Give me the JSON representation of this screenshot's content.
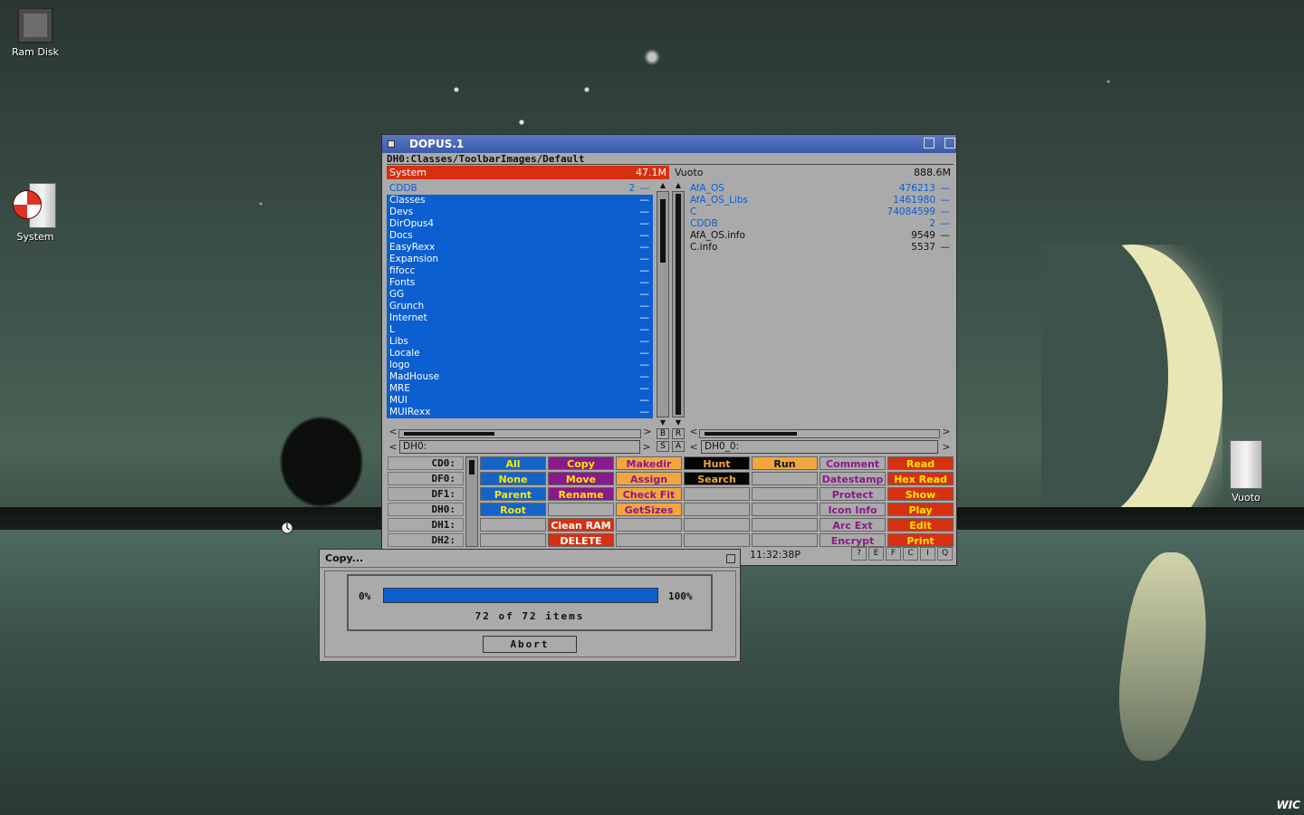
{
  "desktop": {
    "icons": [
      {
        "label": "Ram Disk"
      },
      {
        "label": "System"
      },
      {
        "label": "Vuoto"
      }
    ],
    "corner_logo": "WIC"
  },
  "window": {
    "title": "DOPUS.1",
    "path": "DH0:Classes/ToolbarImages/Default",
    "left": {
      "name": "System",
      "free": "47.1M",
      "path": "DH0:",
      "items": [
        {
          "name": "CDDB",
          "size": "2",
          "tail": "—",
          "kind": "dir"
        },
        {
          "name": "Classes",
          "size": "",
          "tail": "—",
          "kind": "dir-sel"
        },
        {
          "name": "Devs",
          "size": "",
          "tail": "—",
          "kind": "dir-sel"
        },
        {
          "name": "DirOpus4",
          "size": "",
          "tail": "—",
          "kind": "dir-sel"
        },
        {
          "name": "Docs",
          "size": "",
          "tail": "—",
          "kind": "dir-sel"
        },
        {
          "name": "EasyRexx",
          "size": "",
          "tail": "—",
          "kind": "dir-sel"
        },
        {
          "name": "Expansion",
          "size": "",
          "tail": "—",
          "kind": "dir-sel"
        },
        {
          "name": "fifocc",
          "size": "",
          "tail": "—",
          "kind": "dir-sel"
        },
        {
          "name": "Fonts",
          "size": "",
          "tail": "—",
          "kind": "dir-sel"
        },
        {
          "name": "GG",
          "size": "",
          "tail": "—",
          "kind": "dir-sel"
        },
        {
          "name": "Grunch",
          "size": "",
          "tail": "—",
          "kind": "dir-sel"
        },
        {
          "name": "Internet",
          "size": "",
          "tail": "—",
          "kind": "dir-sel"
        },
        {
          "name": "L",
          "size": "",
          "tail": "—",
          "kind": "dir-sel"
        },
        {
          "name": "Libs",
          "size": "",
          "tail": "—",
          "kind": "dir-sel"
        },
        {
          "name": "Locale",
          "size": "",
          "tail": "—",
          "kind": "dir-sel"
        },
        {
          "name": "logo",
          "size": "",
          "tail": "—",
          "kind": "dir-sel"
        },
        {
          "name": "MadHouse",
          "size": "",
          "tail": "—",
          "kind": "dir-sel"
        },
        {
          "name": "MRE",
          "size": "",
          "tail": "—",
          "kind": "dir-sel"
        },
        {
          "name": "MUI",
          "size": "",
          "tail": "—",
          "kind": "dir-sel"
        },
        {
          "name": "MUIRexx",
          "size": "",
          "tail": "—",
          "kind": "dir-sel"
        }
      ]
    },
    "right": {
      "name": "Vuoto",
      "free": "888.6M",
      "path": "DH0_0:",
      "items": [
        {
          "name": "AfA_OS",
          "size": "476213",
          "tail": "—",
          "kind": "dir"
        },
        {
          "name": "AfA_OS_Libs",
          "size": "1461980",
          "tail": "—",
          "kind": "dir"
        },
        {
          "name": "C",
          "size": "74084599",
          "tail": "—",
          "kind": "dir"
        },
        {
          "name": "CDDB",
          "size": "2",
          "tail": "—",
          "kind": "dir"
        },
        {
          "name": "AfA_OS.info",
          "size": "9549",
          "tail": "—",
          "kind": "file"
        },
        {
          "name": "C.info",
          "size": "5537",
          "tail": "—",
          "kind": "file"
        }
      ]
    },
    "mid_buttons": {
      "top": "B",
      "mid": "R",
      "s": "S",
      "a": "A"
    },
    "devices": [
      "CD0:",
      "DF0:",
      "DF1:",
      "DH0:",
      "DH1:",
      "DH2:"
    ],
    "buttons": {
      "col1": [
        "All",
        "None",
        "Parent",
        "Root",
        "",
        ""
      ],
      "col2": [
        "Copy",
        "Move",
        "Rename",
        "",
        "Clean RAM",
        "DELETE"
      ],
      "col3": [
        "Makedir",
        "Assign",
        "Check Fit",
        "GetSizes",
        "",
        ""
      ],
      "col4": [
        "Hunt",
        "Search",
        "",
        "",
        "",
        ""
      ],
      "col5": [
        "Run",
        "",
        "",
        "",
        "",
        ""
      ],
      "col6": [
        "Comment",
        "Datestamp",
        "Protect",
        "Icon Info",
        "Arc Ext",
        "Encrypt"
      ],
      "col7": [
        "Read",
        "Hex Read",
        "Show",
        "Play",
        "Edit",
        "Print"
      ]
    },
    "clock": "11:32:38P",
    "tool_buttons": [
      "?",
      "E",
      "F",
      "C",
      "I",
      "Q"
    ]
  },
  "copy_dialog": {
    "title": "Copy...",
    "min_label": "0%",
    "max_label": "100%",
    "progress": 1.0,
    "count_text": "72 of 72 items",
    "abort_label": "Abort"
  }
}
